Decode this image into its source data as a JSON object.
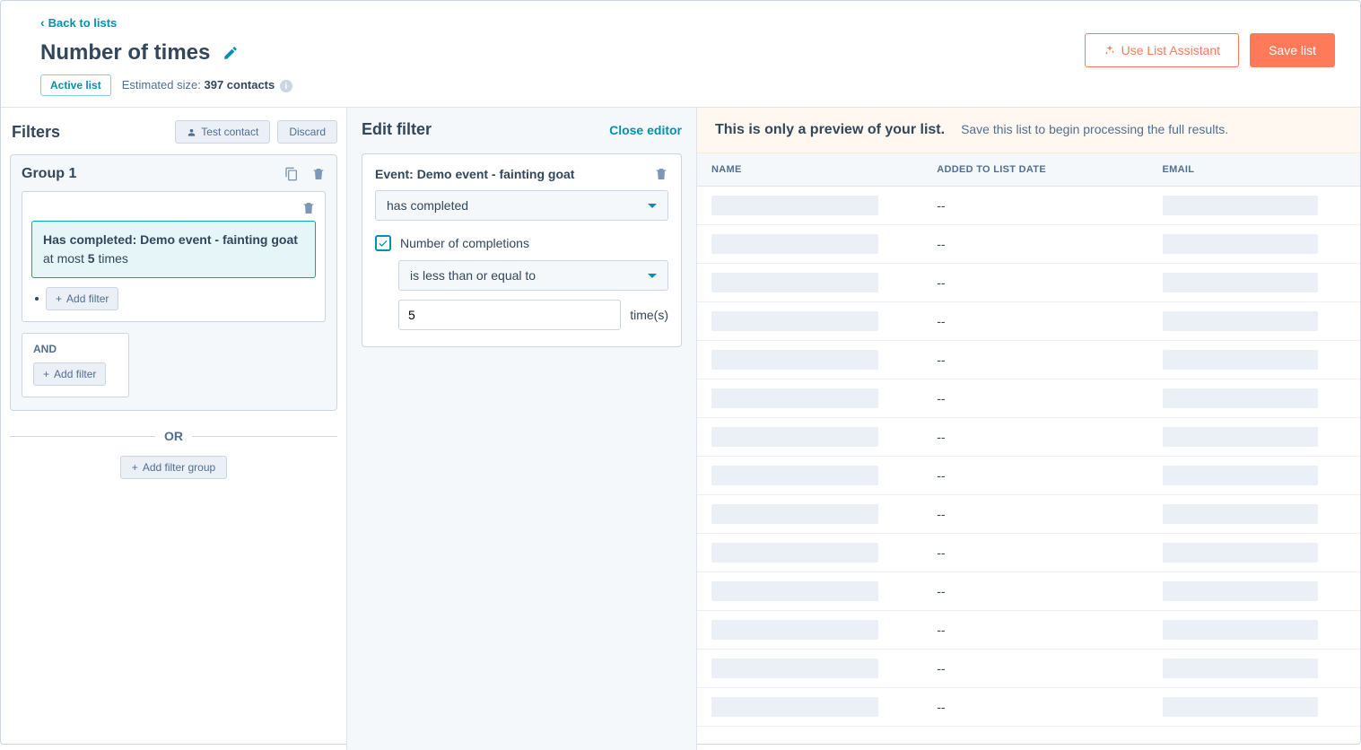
{
  "nav": {
    "back": "Back to lists"
  },
  "header": {
    "title": "Number of times",
    "badge": "Active list",
    "est_prefix": "Estimated size:",
    "est_value": "397 contacts",
    "assistant_btn": "Use List Assistant",
    "save_btn": "Save list"
  },
  "filters": {
    "title": "Filters",
    "test_btn": "Test contact",
    "discard_btn": "Discard",
    "group_title": "Group 1",
    "token_prefix": "Has completed:",
    "token_event": "Demo event - fainting goat",
    "token_mid": "at most",
    "token_count": "5",
    "token_suffix": "times",
    "add_filter": "Add filter",
    "and_label": "AND",
    "or_label": "OR",
    "add_group": "Add filter group"
  },
  "edit": {
    "title": "Edit filter",
    "close": "Close editor",
    "event_prefix": "Event:",
    "event_name": "Demo event - fainting goat",
    "completion_select": "has completed",
    "check_label": "Number of completions",
    "comparator": "is less than or equal to",
    "count_value": "5",
    "times_label": "time(s)"
  },
  "preview": {
    "banner_strong": "This is only a preview of your list.",
    "banner_sub": "Save this list to begin processing the full results.",
    "cols": {
      "name": "NAME",
      "date": "ADDED TO LIST DATE",
      "email": "EMAIL"
    },
    "rows": [
      {
        "date": "--"
      },
      {
        "date": "--"
      },
      {
        "date": "--"
      },
      {
        "date": "--"
      },
      {
        "date": "--"
      },
      {
        "date": "--"
      },
      {
        "date": "--"
      },
      {
        "date": "--"
      },
      {
        "date": "--"
      },
      {
        "date": "--"
      },
      {
        "date": "--"
      },
      {
        "date": "--"
      },
      {
        "date": "--"
      },
      {
        "date": "--"
      }
    ]
  }
}
